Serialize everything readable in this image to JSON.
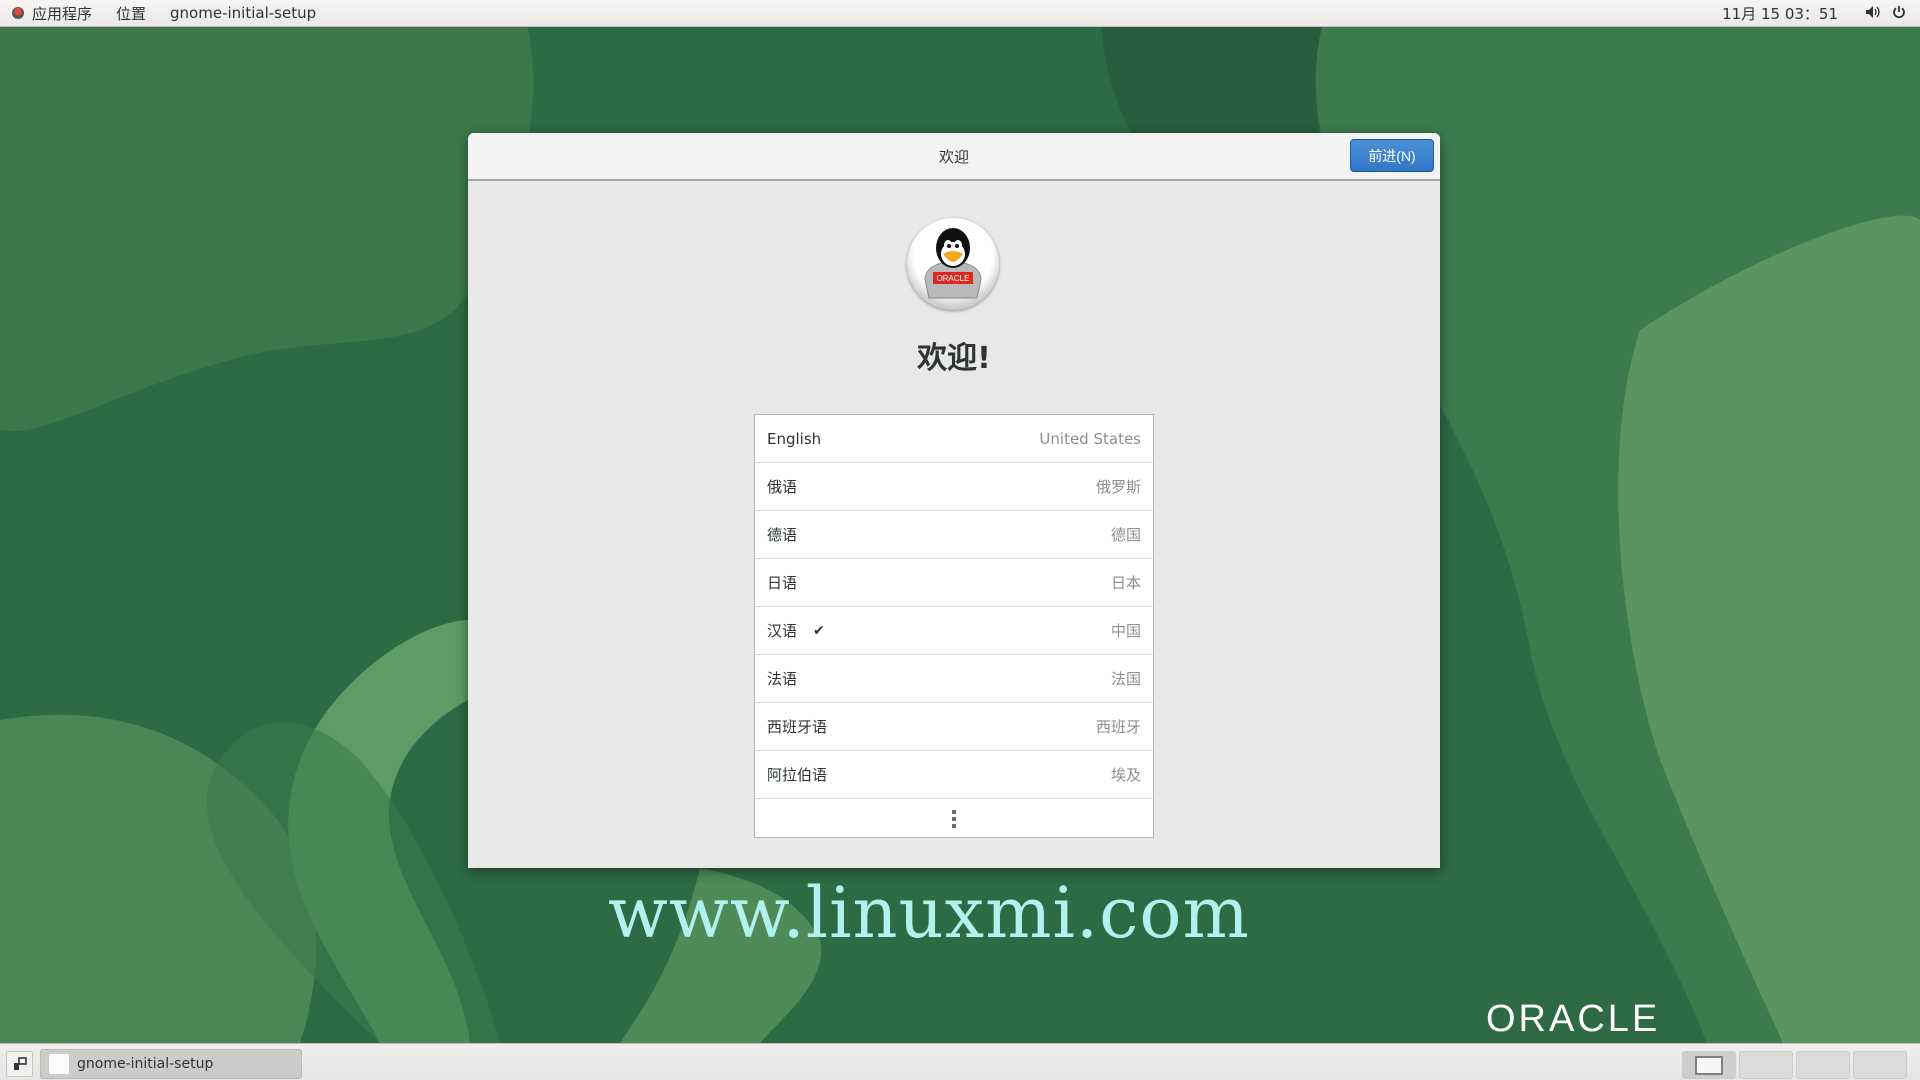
{
  "topbar": {
    "apps_label": "应用程序",
    "places_label": "位置",
    "active_app": "gnome-initial-setup",
    "clock": "11月 15  03：51",
    "volume_icon": "volume-icon",
    "power_icon": "power-icon"
  },
  "dialog": {
    "title": "欢迎",
    "next_button": "前进(N)",
    "heading": "欢迎!",
    "logo_text": "ORACLE",
    "languages": [
      {
        "name": "English",
        "region": "United States",
        "selected": false
      },
      {
        "name": "俄语",
        "region": "俄罗斯",
        "selected": false
      },
      {
        "name": "德语",
        "region": "德国",
        "selected": false
      },
      {
        "name": "日语",
        "region": "日本",
        "selected": false
      },
      {
        "name": "汉语",
        "region": "中国",
        "selected": true,
        "check": "✔"
      },
      {
        "name": "法语",
        "region": "法国",
        "selected": false
      },
      {
        "name": "西班牙语",
        "region": "西班牙",
        "selected": false
      },
      {
        "name": "阿拉伯语",
        "region": "埃及",
        "selected": false
      }
    ],
    "more_icon": "more-vertical-icon"
  },
  "wallpaper": {
    "watermark": "www.linuxmi.com",
    "brand": "ORACLE"
  },
  "bottombar": {
    "task_label": "gnome-initial-setup",
    "workspaces": 4,
    "active_workspace": 1
  }
}
